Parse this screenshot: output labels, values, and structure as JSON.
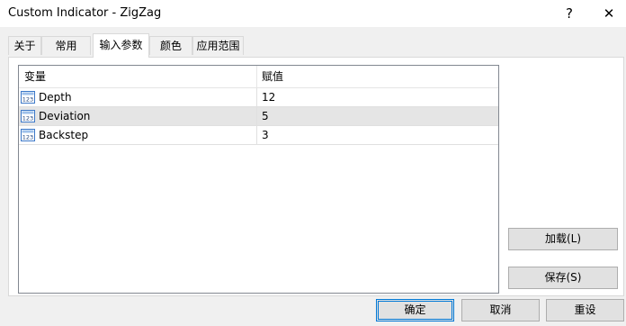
{
  "window": {
    "title": "Custom Indicator - ZigZag",
    "help_glyph": "?",
    "close_glyph": "✕"
  },
  "tabs": [
    {
      "label": "关于"
    },
    {
      "label": "常用"
    },
    {
      "label": "输入参数",
      "active": true
    },
    {
      "label": "颜色"
    },
    {
      "label": "应用范围"
    }
  ],
  "table": {
    "headers": {
      "variable": "变量",
      "value": "赋值"
    },
    "rows": [
      {
        "icon": "int-123-icon",
        "icon_text": "123",
        "name": "Depth",
        "value": "12",
        "selected": false
      },
      {
        "icon": "int-123-icon",
        "icon_text": "123",
        "name": "Deviation",
        "value": "5",
        "selected": true
      },
      {
        "icon": "int-123-icon",
        "icon_text": "123",
        "name": "Backstep",
        "value": "3",
        "selected": false
      }
    ]
  },
  "side_buttons": {
    "load": "加载(L)",
    "save": "保存(S)"
  },
  "footer": {
    "ok": "确定",
    "cancel": "取消",
    "reset": "重设"
  },
  "colors": {
    "accent": "#0078d7",
    "selected_row": "#e5e5e5",
    "icon_blue": "#3c78c8"
  }
}
